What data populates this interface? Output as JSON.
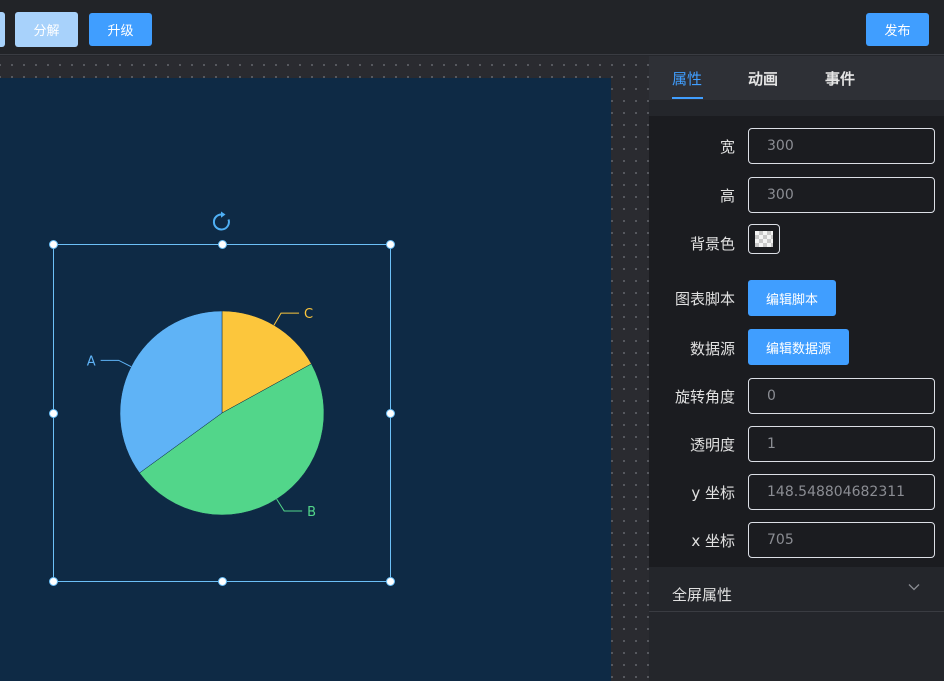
{
  "toolbar": {
    "decompose_label": "分解",
    "upgrade_label": "升级",
    "publish_label": "发布"
  },
  "panel": {
    "tabs": [
      {
        "label": "属性",
        "active": true
      },
      {
        "label": "动画",
        "active": false
      },
      {
        "label": "事件",
        "active": false
      }
    ],
    "width": {
      "label": "宽",
      "value": "300"
    },
    "height": {
      "label": "高",
      "value": "300"
    },
    "background": {
      "label": "背景色"
    },
    "chart_script": {
      "label": "图表脚本",
      "button": "编辑脚本"
    },
    "data_source": {
      "label": "数据源",
      "button": "编辑数据源"
    },
    "rotation": {
      "label": "旋转角度",
      "value": "0"
    },
    "opacity": {
      "label": "透明度",
      "value": "1"
    },
    "y": {
      "label": "y 坐标",
      "value": "148.548804682311"
    },
    "x": {
      "label": "x 坐标",
      "value": "705"
    },
    "fullscreen": {
      "label": "全屏属性"
    }
  },
  "chart_data": {
    "type": "pie",
    "categories": [
      "A",
      "B",
      "C"
    ],
    "values": [
      35,
      48,
      17
    ],
    "colors": [
      "#5fb3f6",
      "#52d68a",
      "#fcc63c"
    ]
  },
  "colors": {
    "accent": "#409eff",
    "screen_bg": "#0e2a45",
    "selection": "#6cc0f7"
  }
}
